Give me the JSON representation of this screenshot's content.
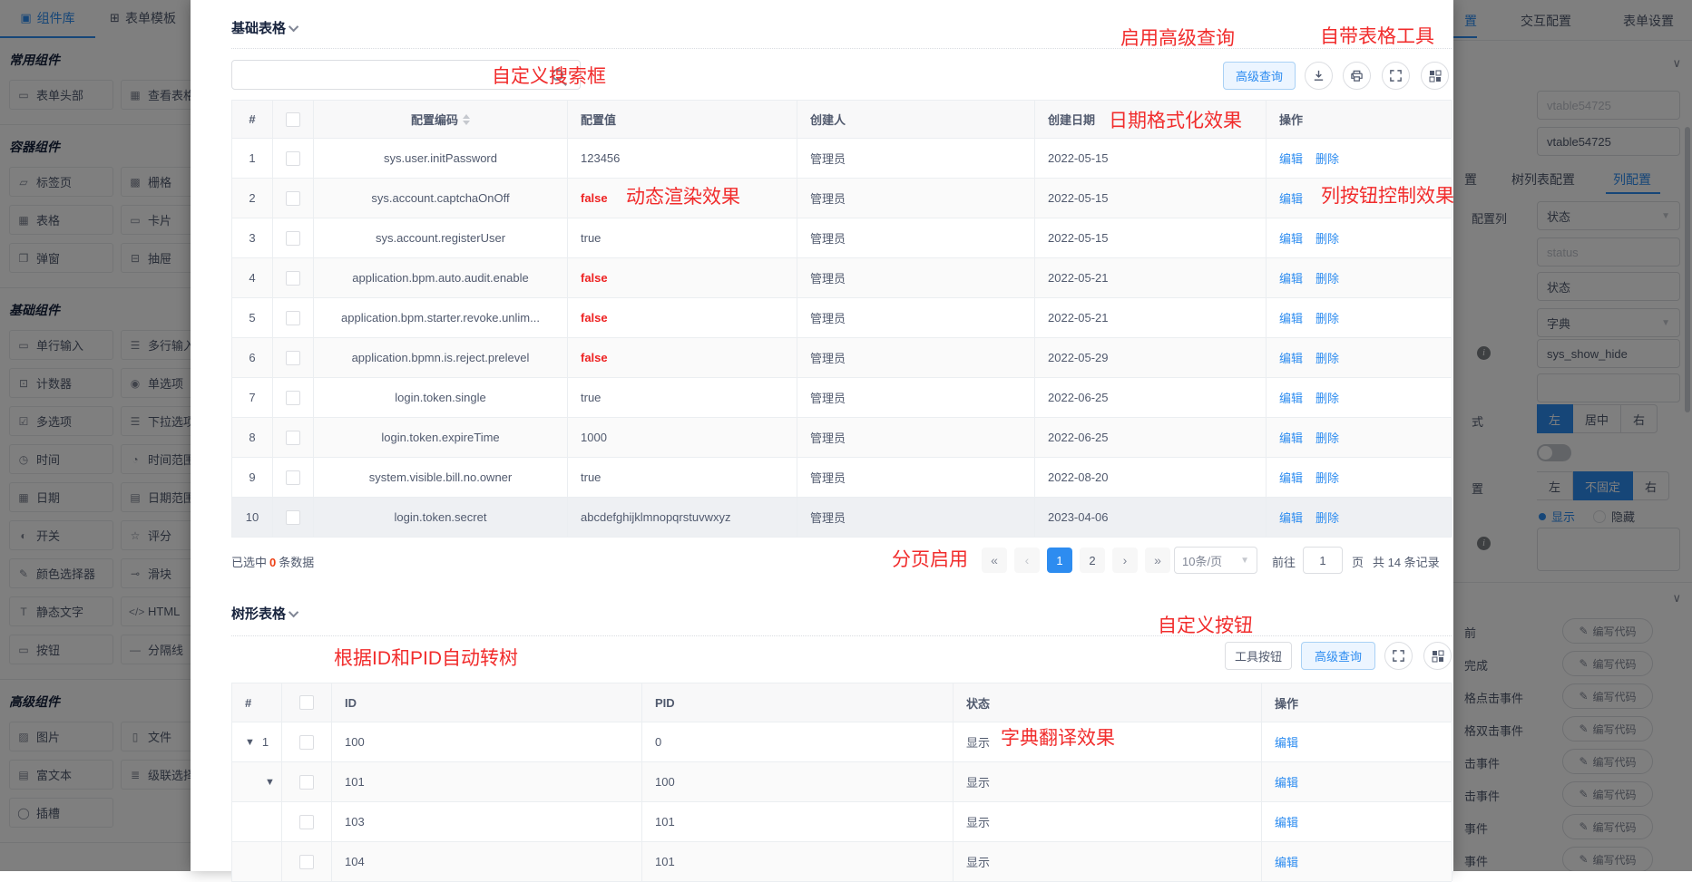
{
  "left_sidebar": {
    "tabs": [
      {
        "label": "组件库",
        "icon": "▣",
        "active": true
      },
      {
        "label": "表单模板",
        "icon": "⊞",
        "active": false
      }
    ],
    "sections": [
      {
        "title": "常用组件",
        "items": [
          {
            "icon": "▭",
            "label": "表单头部"
          },
          {
            "icon": "▦",
            "label": "查看表格"
          }
        ]
      },
      {
        "title": "容器组件",
        "items": [
          {
            "icon": "▱",
            "label": "标签页"
          },
          {
            "icon": "▩",
            "label": "栅格"
          },
          {
            "icon": "▦",
            "label": "表格"
          },
          {
            "icon": "▭",
            "label": "卡片"
          },
          {
            "icon": "❐",
            "label": "弹窗"
          },
          {
            "icon": "⊟",
            "label": "抽屉"
          }
        ]
      },
      {
        "title": "基础组件",
        "items": [
          {
            "icon": "▭",
            "label": "单行输入"
          },
          {
            "icon": "☰",
            "label": "多行输入"
          },
          {
            "icon": "⊡",
            "label": "计数器"
          },
          {
            "icon": "◉",
            "label": "单选项"
          },
          {
            "icon": "☑",
            "label": "多选项"
          },
          {
            "icon": "☰",
            "label": "下拉选项"
          },
          {
            "icon": "◷",
            "label": "时间"
          },
          {
            "icon": "◔",
            "label": "时间范围"
          },
          {
            "icon": "▦",
            "label": "日期"
          },
          {
            "icon": "▤",
            "label": "日期范围"
          },
          {
            "icon": "◐",
            "label": "开关"
          },
          {
            "icon": "☆",
            "label": "评分"
          },
          {
            "icon": "✎",
            "label": "颜色选择器"
          },
          {
            "icon": "⊸",
            "label": "滑块"
          },
          {
            "icon": "T",
            "label": "静态文字"
          },
          {
            "icon": "</>",
            "label": "HTML"
          },
          {
            "icon": "▭",
            "label": "按钮"
          },
          {
            "icon": "—",
            "label": "分隔线"
          }
        ]
      },
      {
        "title": "高级组件",
        "items": [
          {
            "icon": "▨",
            "label": "图片"
          },
          {
            "icon": "▯",
            "label": "文件"
          },
          {
            "icon": "▤",
            "label": "富文本"
          },
          {
            "icon": "≣",
            "label": "级联选择"
          },
          {
            "icon": "◯",
            "label": "插槽"
          }
        ]
      }
    ]
  },
  "basic_section": {
    "title": "基础表格",
    "toolbar": {
      "advanced_query": "高级查询"
    },
    "table": {
      "headers": {
        "index": "#",
        "code": "配置编码",
        "value": "配置值",
        "creator": "创建人",
        "date": "创建日期",
        "action": "操作"
      },
      "edit_label": "编辑",
      "delete_label": "删除",
      "rows": [
        {
          "num": "1",
          "code": "sys.user.initPassword",
          "value": "123456",
          "red": false,
          "creator": "管理员",
          "date": "2022-05-15",
          "no_delete": false
        },
        {
          "num": "2",
          "code": "sys.account.captchaOnOff",
          "value": "false",
          "red": true,
          "creator": "管理员",
          "date": "2022-05-15",
          "no_delete": true
        },
        {
          "num": "3",
          "code": "sys.account.registerUser",
          "value": "true",
          "red": false,
          "creator": "管理员",
          "date": "2022-05-15",
          "no_delete": false
        },
        {
          "num": "4",
          "code": "application.bpm.auto.audit.enable",
          "value": "false",
          "red": true,
          "creator": "管理员",
          "date": "2022-05-21",
          "no_delete": false
        },
        {
          "num": "5",
          "code": "application.bpm.starter.revoke.unlim...",
          "value": "false",
          "red": true,
          "creator": "管理员",
          "date": "2022-05-21",
          "no_delete": false
        },
        {
          "num": "6",
          "code": "application.bpmn.is.reject.prelevel",
          "value": "false",
          "red": true,
          "creator": "管理员",
          "date": "2022-05-29",
          "no_delete": false
        },
        {
          "num": "7",
          "code": "login.token.single",
          "value": "true",
          "red": false,
          "creator": "管理员",
          "date": "2022-06-25",
          "no_delete": false
        },
        {
          "num": "8",
          "code": "login.token.expireTime",
          "value": "1000",
          "red": false,
          "creator": "管理员",
          "date": "2022-06-25",
          "no_delete": false
        },
        {
          "num": "9",
          "code": "system.visible.bill.no.owner",
          "value": "true",
          "red": false,
          "creator": "管理员",
          "date": "2022-08-20",
          "no_delete": false
        },
        {
          "num": "10",
          "code": "login.token.secret",
          "value": "abcdefghijklmnopqrstuvwxyz",
          "red": false,
          "creator": "管理员",
          "date": "2023-04-06",
          "no_delete": false,
          "hover": true
        }
      ]
    },
    "pagination": {
      "selected_prefix": "已选中",
      "selected_count": "0",
      "selected_suffix": "条数据",
      "pages": [
        {
          "label": "1",
          "active": true
        },
        {
          "label": "2",
          "active": false
        }
      ],
      "page_size": "10条/页",
      "goto_label": "前往",
      "goto_value": "1",
      "page_label": "页",
      "total": "共 14 条记录"
    }
  },
  "tree_section": {
    "title": "树形表格",
    "toolbar": {
      "tool_button": "工具按钮",
      "advanced_query": "高级查询"
    },
    "table": {
      "headers": {
        "index": "#",
        "id": "ID",
        "pid": "PID",
        "status": "状态",
        "action": "操作"
      },
      "edit_label": "编辑",
      "rows": [
        {
          "expand": true,
          "num": "1",
          "id": "100",
          "pid": "0",
          "status": "显示",
          "ind1": false
        },
        {
          "expand": true,
          "num": "",
          "id": "101",
          "pid": "100",
          "status": "显示",
          "ind1": true
        },
        {
          "expand": false,
          "num": "",
          "id": "103",
          "pid": "101",
          "status": "显示",
          "ind1": false
        },
        {
          "expand": false,
          "num": "",
          "id": "104",
          "pid": "101",
          "status": "显示",
          "ind1": false
        }
      ]
    }
  },
  "right_sidebar": {
    "tab_fragment": "置",
    "tabs": [
      {
        "label": "交互配置"
      },
      {
        "label": "表单设置"
      }
    ],
    "name_placeholder": "vtable54725",
    "name_value": "vtable54725",
    "inner_tab_fragment": "置",
    "inner_tabs": [
      {
        "label": "树列表配置",
        "active": false
      },
      {
        "label": "列配置",
        "active": true
      }
    ],
    "config_col_label": "配置列",
    "config_col_value": "状态",
    "status_placeholder": "status",
    "title_value": "状态",
    "dict_select": "字典",
    "dict_code": "sys_show_hide",
    "align_label": "式",
    "align_options": [
      {
        "label": "左",
        "active": true
      },
      {
        "label": "居中",
        "active": false
      },
      {
        "label": "右",
        "active": false
      }
    ],
    "fixed_label": "置",
    "fixed_options": [
      {
        "label": "左",
        "active": false
      },
      {
        "label": "不固定",
        "active": true
      },
      {
        "label": "右",
        "active": false
      }
    ],
    "radio_options": [
      {
        "label": "显示",
        "on": true
      },
      {
        "label": "隐藏",
        "on": false
      }
    ],
    "event_rows": [
      {
        "label": "前"
      },
      {
        "label": "完成"
      },
      {
        "label": "格点击事件"
      },
      {
        "label": "格双击事件"
      },
      {
        "label": "击事件"
      },
      {
        "label": "击事件"
      },
      {
        "label": "事件"
      },
      {
        "label": "事件"
      }
    ],
    "event_button": "编写代码"
  },
  "annotations": {
    "search_box": "自定义搜索框",
    "advanced_query": "启用高级查询",
    "table_tools": "自带表格工具",
    "date_format": "日期格式化效果",
    "dynamic_render": "动态渲染效果",
    "column_button": "列按钮控制效果",
    "pagination": "分页启用",
    "tree_auto": "根据ID和PID自动转树",
    "custom_button": "自定义按钮",
    "dict_translate": "字典翻译效果"
  },
  "colors": {
    "accent": "#2d8cf0",
    "annotation_red": "#f12c2c",
    "false_red": "#ee2222",
    "header_bg": "#f8f8f9"
  }
}
